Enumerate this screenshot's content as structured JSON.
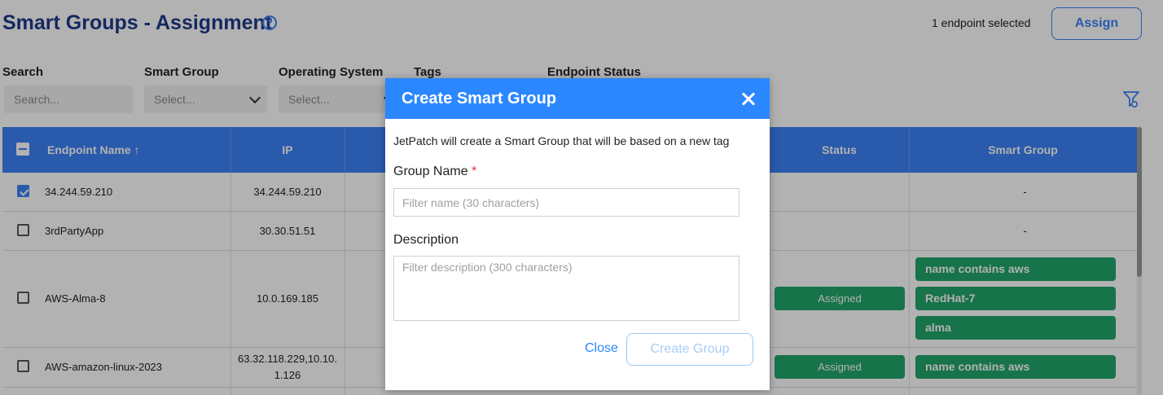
{
  "header": {
    "title": "Smart Groups - Assignment",
    "help_glyph": "?",
    "selection_text": "1 endpoint selected",
    "assign_label": "Assign"
  },
  "filters": {
    "search": {
      "label": "Search",
      "placeholder": "Search..."
    },
    "smart_group": {
      "label": "Smart Group",
      "placeholder": "Select..."
    },
    "os": {
      "label": "Operating System",
      "placeholder": "Select..."
    },
    "tags": {
      "label": "Tags"
    },
    "status": {
      "label": "Endpoint Status"
    }
  },
  "table": {
    "columns": {
      "name": "Endpoint Name ↑",
      "ip": "IP",
      "status": "Status",
      "smart_group": "Smart Group"
    },
    "rows": [
      {
        "checked": true,
        "name": "34.244.59.210",
        "ip": "34.244.59.210",
        "status": "",
        "groups": [
          "-"
        ]
      },
      {
        "checked": false,
        "name": "3rdPartyApp",
        "ip": "30.30.51.51",
        "status": "",
        "groups": [
          "-"
        ]
      },
      {
        "checked": false,
        "name": "AWS-Alma-8",
        "ip": "10.0.169.185",
        "status": "Assigned",
        "groups": [
          "name contains aws",
          "RedHat-7",
          "alma"
        ]
      },
      {
        "checked": false,
        "name": "AWS-amazon-linux-2023",
        "ip_line1": "63.32.118.229,10.10.",
        "ip_line2": "1.126",
        "status": "Assigned",
        "groups": [
          "name contains aws"
        ]
      }
    ]
  },
  "modal": {
    "title": "Create Smart Group",
    "description": "JetPatch will create a Smart Group that will be based on a new tag",
    "group_name_label": "Group Name",
    "required_mark": "*",
    "group_name_placeholder": "Filter name (30 characters)",
    "description_label": "Description",
    "description_placeholder": "Filter description (300 characters)",
    "close_label": "Close",
    "create_label": "Create Group"
  },
  "colors": {
    "primary": "#3b82f6",
    "modal_header": "#2b87ff",
    "badge_green": "#22a56a",
    "title_blue": "#1f3a8a"
  }
}
